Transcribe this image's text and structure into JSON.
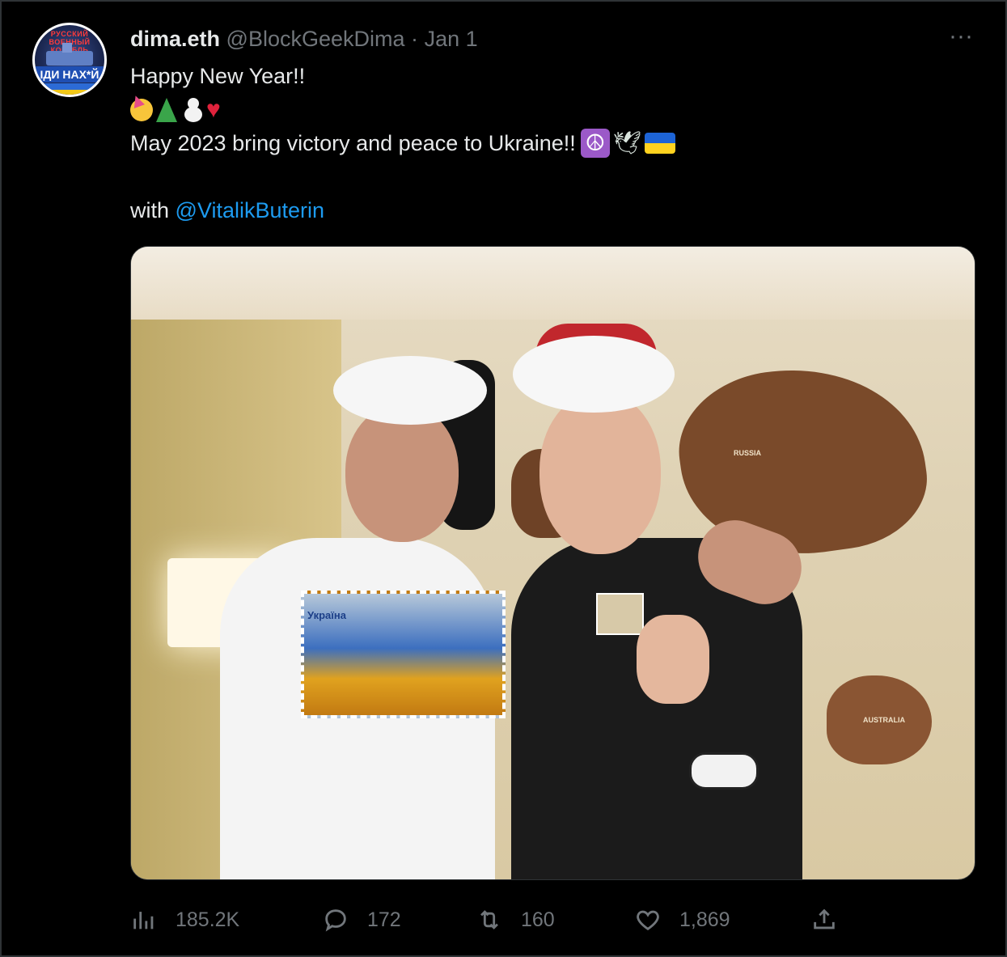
{
  "tweet": {
    "author": {
      "name": "dima.eth",
      "handle": "@BlockGeekDima",
      "separator": "·",
      "date": "Jan 1"
    },
    "avatar": {
      "ring_text": "РУССКИЙ ВОЕННЫЙ КОРАБЛЬ",
      "slogan": "ІДИ НАХ*Й"
    },
    "more_label": "···",
    "lines": {
      "line1": "Happy New Year!!",
      "line3": "May 2023 bring victory and peace to Ukraine!!",
      "with_prefix": "with ",
      "mention": "@VitalikButerin"
    },
    "emojis_line2": [
      "face-with-party-horn",
      "christmas-tree",
      "snowman",
      "red-heart"
    ],
    "emojis_line3": [
      "peace-symbol",
      "dove",
      "ukraine-flag"
    ],
    "media": {
      "stamp_text": "Україна",
      "map_labels": [
        "RUSSIA",
        "AUSTRALIA"
      ]
    },
    "stats": {
      "views": "185.2K",
      "replies": "172",
      "retweets": "160",
      "likes": "1,869"
    },
    "colors": {
      "accent": "#1d9bf0",
      "muted": "#71767b",
      "text": "#e7e9ea",
      "background": "#000000"
    }
  }
}
